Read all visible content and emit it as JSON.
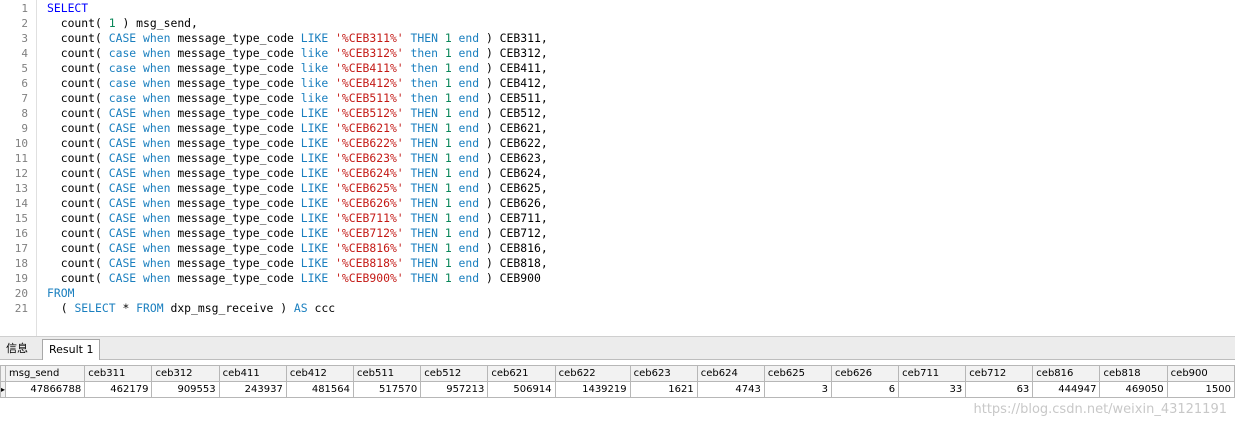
{
  "editor": {
    "lines": [
      {
        "n": "1",
        "html": "<span class=\"kw\">SELECT</span>"
      },
      {
        "n": "2",
        "html": "  count( <span class=\"num\">1</span> ) msg_send,"
      },
      {
        "n": "3",
        "html": "  count( <span class=\"kc\">CASE</span> <span class=\"kc\">when</span> message_type_code <span class=\"kc\">LIKE</span> <span class=\"str\">'%CEB311%'</span> <span class=\"kc\">THEN</span> <span class=\"num\">1</span> <span class=\"kc\">end</span> ) CEB311,"
      },
      {
        "n": "4",
        "html": "  count( <span class=\"kc\">case</span> <span class=\"kc\">when</span> message_type_code <span class=\"kc\">like</span> <span class=\"str\">'%CEB312%'</span> <span class=\"kc\">then</span> <span class=\"num\">1</span> <span class=\"kc\">end</span> ) CEB312,"
      },
      {
        "n": "5",
        "html": "  count( <span class=\"kc\">case</span> <span class=\"kc\">when</span> message_type_code <span class=\"kc\">like</span> <span class=\"str\">'%CEB411%'</span> <span class=\"kc\">then</span> <span class=\"num\">1</span> <span class=\"kc\">end</span> ) CEB411,"
      },
      {
        "n": "6",
        "html": "  count( <span class=\"kc\">case</span> <span class=\"kc\">when</span> message_type_code <span class=\"kc\">like</span> <span class=\"str\">'%CEB412%'</span> <span class=\"kc\">then</span> <span class=\"num\">1</span> <span class=\"kc\">end</span> ) CEB412,"
      },
      {
        "n": "7",
        "html": "  count( <span class=\"kc\">case</span> <span class=\"kc\">when</span> message_type_code <span class=\"kc\">like</span> <span class=\"str\">'%CEB511%'</span> <span class=\"kc\">then</span> <span class=\"num\">1</span> <span class=\"kc\">end</span> ) CEB511,"
      },
      {
        "n": "8",
        "html": "  count( <span class=\"kc\">CASE</span> <span class=\"kc\">when</span> message_type_code <span class=\"kc\">LIKE</span> <span class=\"str\">'%CEB512%'</span> <span class=\"kc\">THEN</span> <span class=\"num\">1</span> <span class=\"kc\">end</span> ) CEB512,"
      },
      {
        "n": "9",
        "html": "  count( <span class=\"kc\">CASE</span> <span class=\"kc\">when</span> message_type_code <span class=\"kc\">LIKE</span> <span class=\"str\">'%CEB621%'</span> <span class=\"kc\">THEN</span> <span class=\"num\">1</span> <span class=\"kc\">end</span> ) CEB621,"
      },
      {
        "n": "10",
        "html": "  count( <span class=\"kc\">CASE</span> <span class=\"kc\">when</span> message_type_code <span class=\"kc\">LIKE</span> <span class=\"str\">'%CEB622%'</span> <span class=\"kc\">THEN</span> <span class=\"num\">1</span> <span class=\"kc\">end</span> ) CEB622,"
      },
      {
        "n": "11",
        "html": "  count( <span class=\"kc\">CASE</span> <span class=\"kc\">when</span> message_type_code <span class=\"kc\">LIKE</span> <span class=\"str\">'%CEB623%'</span> <span class=\"kc\">THEN</span> <span class=\"num\">1</span> <span class=\"kc\">end</span> ) CEB623,"
      },
      {
        "n": "12",
        "html": "  count( <span class=\"kc\">CASE</span> <span class=\"kc\">when</span> message_type_code <span class=\"kc\">LIKE</span> <span class=\"str\">'%CEB624%'</span> <span class=\"kc\">THEN</span> <span class=\"num\">1</span> <span class=\"kc\">end</span> ) CEB624,"
      },
      {
        "n": "13",
        "html": "  count( <span class=\"kc\">CASE</span> <span class=\"kc\">when</span> message_type_code <span class=\"kc\">LIKE</span> <span class=\"str\">'%CEB625%'</span> <span class=\"kc\">THEN</span> <span class=\"num\">1</span> <span class=\"kc\">end</span> ) CEB625,"
      },
      {
        "n": "14",
        "html": "  count( <span class=\"kc\">CASE</span> <span class=\"kc\">when</span> message_type_code <span class=\"kc\">LIKE</span> <span class=\"str\">'%CEB626%'</span> <span class=\"kc\">THEN</span> <span class=\"num\">1</span> <span class=\"kc\">end</span> ) CEB626,"
      },
      {
        "n": "15",
        "html": "  count( <span class=\"kc\">CASE</span> <span class=\"kc\">when</span> message_type_code <span class=\"kc\">LIKE</span> <span class=\"str\">'%CEB711%'</span> <span class=\"kc\">THEN</span> <span class=\"num\">1</span> <span class=\"kc\">end</span> ) CEB711,"
      },
      {
        "n": "16",
        "html": "  count( <span class=\"kc\">CASE</span> <span class=\"kc\">when</span> message_type_code <span class=\"kc\">LIKE</span> <span class=\"str\">'%CEB712%'</span> <span class=\"kc\">THEN</span> <span class=\"num\">1</span> <span class=\"kc\">end</span> ) CEB712,"
      },
      {
        "n": "17",
        "html": "  count( <span class=\"kc\">CASE</span> <span class=\"kc\">when</span> message_type_code <span class=\"kc\">LIKE</span> <span class=\"str\">'%CEB816%'</span> <span class=\"kc\">THEN</span> <span class=\"num\">1</span> <span class=\"kc\">end</span> ) CEB816,"
      },
      {
        "n": "18",
        "html": "  count( <span class=\"kc\">CASE</span> <span class=\"kc\">when</span> message_type_code <span class=\"kc\">LIKE</span> <span class=\"str\">'%CEB818%'</span> <span class=\"kc\">THEN</span> <span class=\"num\">1</span> <span class=\"kc\">end</span> ) CEB818,"
      },
      {
        "n": "19",
        "html": "  count( <span class=\"kc\">CASE</span> <span class=\"kc\">when</span> message_type_code <span class=\"kc\">LIKE</span> <span class=\"str\">'%CEB900%'</span> <span class=\"kc\">THEN</span> <span class=\"num\">1</span> <span class=\"kc\">end</span> ) CEB900"
      },
      {
        "n": "20",
        "html": "<span class=\"kc\">FROM</span>"
      },
      {
        "n": "21",
        "html": "  ( <span class=\"kc\">SELECT</span> * <span class=\"kc\">FROM</span> dxp_msg_receive ) <span class=\"kc\">AS</span> ccc"
      }
    ]
  },
  "tabs": {
    "info": "信息",
    "result": "Result 1"
  },
  "grid": {
    "columns": [
      "msg_send",
      "ceb311",
      "ceb312",
      "ceb411",
      "ceb412",
      "ceb511",
      "ceb512",
      "ceb621",
      "ceb622",
      "ceb623",
      "ceb624",
      "ceb625",
      "ceb626",
      "ceb711",
      "ceb712",
      "ceb816",
      "ceb818",
      "ceb900"
    ],
    "widths": [
      74,
      62,
      62,
      62,
      62,
      62,
      62,
      62,
      70,
      62,
      62,
      62,
      62,
      62,
      62,
      62,
      62,
      62
    ],
    "row": [
      "47866788",
      "462179",
      "909553",
      "243937",
      "481564",
      "517570",
      "957213",
      "506914",
      "1439219",
      "1621",
      "4743",
      "3",
      "6",
      "33",
      "63",
      "444947",
      "469050",
      "1500"
    ]
  },
  "watermark": "https://blog.csdn.net/weixin_43121191"
}
